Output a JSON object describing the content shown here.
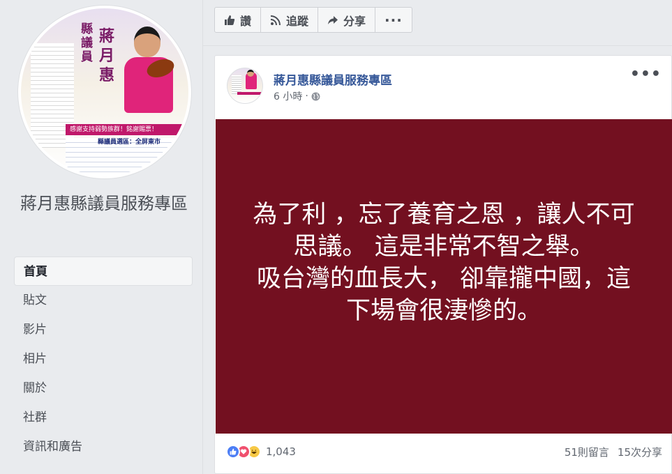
{
  "page": {
    "name": "蔣月惠縣議員服務專區",
    "profile_photo": {
      "vertical_title": "縣議員",
      "vertical_name": "蔣月惠",
      "banner_text": "感謝支持弱勢族群！銘謝賜票！",
      "footer_title": "縣議員選區：全屏東市"
    }
  },
  "nav": {
    "items": [
      {
        "label": "首頁",
        "active": true
      },
      {
        "label": "貼文",
        "active": false
      },
      {
        "label": "影片",
        "active": false
      },
      {
        "label": "相片",
        "active": false
      },
      {
        "label": "關於",
        "active": false
      },
      {
        "label": "社群",
        "active": false
      },
      {
        "label": "資訊和廣告",
        "active": false
      }
    ]
  },
  "actions": {
    "like_label": "讚",
    "follow_label": "追蹤",
    "share_label": "分享",
    "more_label": "···"
  },
  "post": {
    "author": "蔣月惠縣議員服務專區",
    "time": "6 小時",
    "separator": "·",
    "more_label": "•••",
    "image_text": {
      "paragraph1": "為了利 ，忘了養育之恩 ，讓人不可思議。 這是非常不智之舉。",
      "paragraph2": "吸台灣的血長大， 卻靠攏中國，這下場會很淒慘的。"
    },
    "background_color": "#731020",
    "reactions_count": "1,043",
    "comments": "51則留言",
    "shares": "15次分享",
    "reaction_icons": [
      "like-icon",
      "love-icon",
      "haha-icon"
    ]
  },
  "colors": {
    "link": "#365899",
    "page_bg": "#e9ebee"
  }
}
